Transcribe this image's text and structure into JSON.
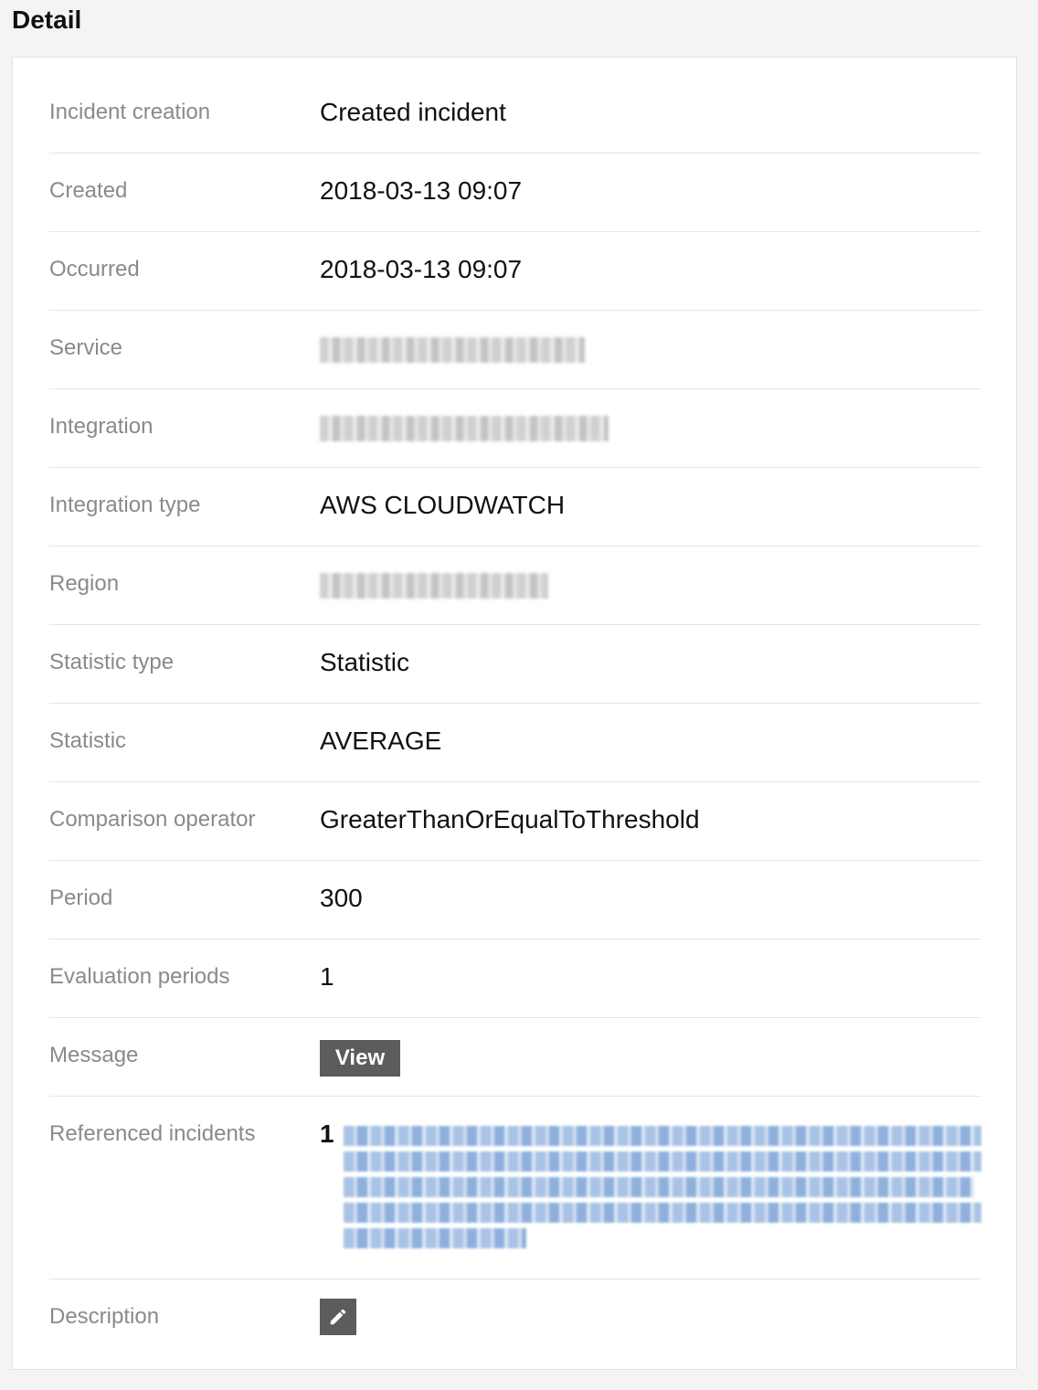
{
  "page": {
    "title": "Detail"
  },
  "fields": {
    "incident_creation": {
      "label": "Incident creation",
      "value": "Created incident"
    },
    "created": {
      "label": "Created",
      "value": "2018-03-13 09:07"
    },
    "occurred": {
      "label": "Occurred",
      "value": "2018-03-13 09:07"
    },
    "service": {
      "label": "Service"
    },
    "integration": {
      "label": "Integration"
    },
    "integration_type": {
      "label": "Integration type",
      "value": "AWS CLOUDWATCH"
    },
    "region": {
      "label": "Region"
    },
    "statistic_type": {
      "label": "Statistic type",
      "value": "Statistic"
    },
    "statistic": {
      "label": "Statistic",
      "value": "AVERAGE"
    },
    "comparison_operator": {
      "label": "Comparison operator",
      "value": "GreaterThanOrEqualToThreshold"
    },
    "period": {
      "label": "Period",
      "value": "300"
    },
    "evaluation_periods": {
      "label": "Evaluation periods",
      "value": "1"
    },
    "message": {
      "label": "Message",
      "button_label": "View"
    },
    "referenced_incidents": {
      "label": "Referenced incidents",
      "count": "1"
    },
    "description": {
      "label": "Description",
      "edit_icon": "pencil-icon"
    }
  },
  "colors": {
    "label": "#8a8a8a",
    "value": "#111111",
    "button_bg": "#5c5c5c",
    "link": "#4a7fd0"
  }
}
